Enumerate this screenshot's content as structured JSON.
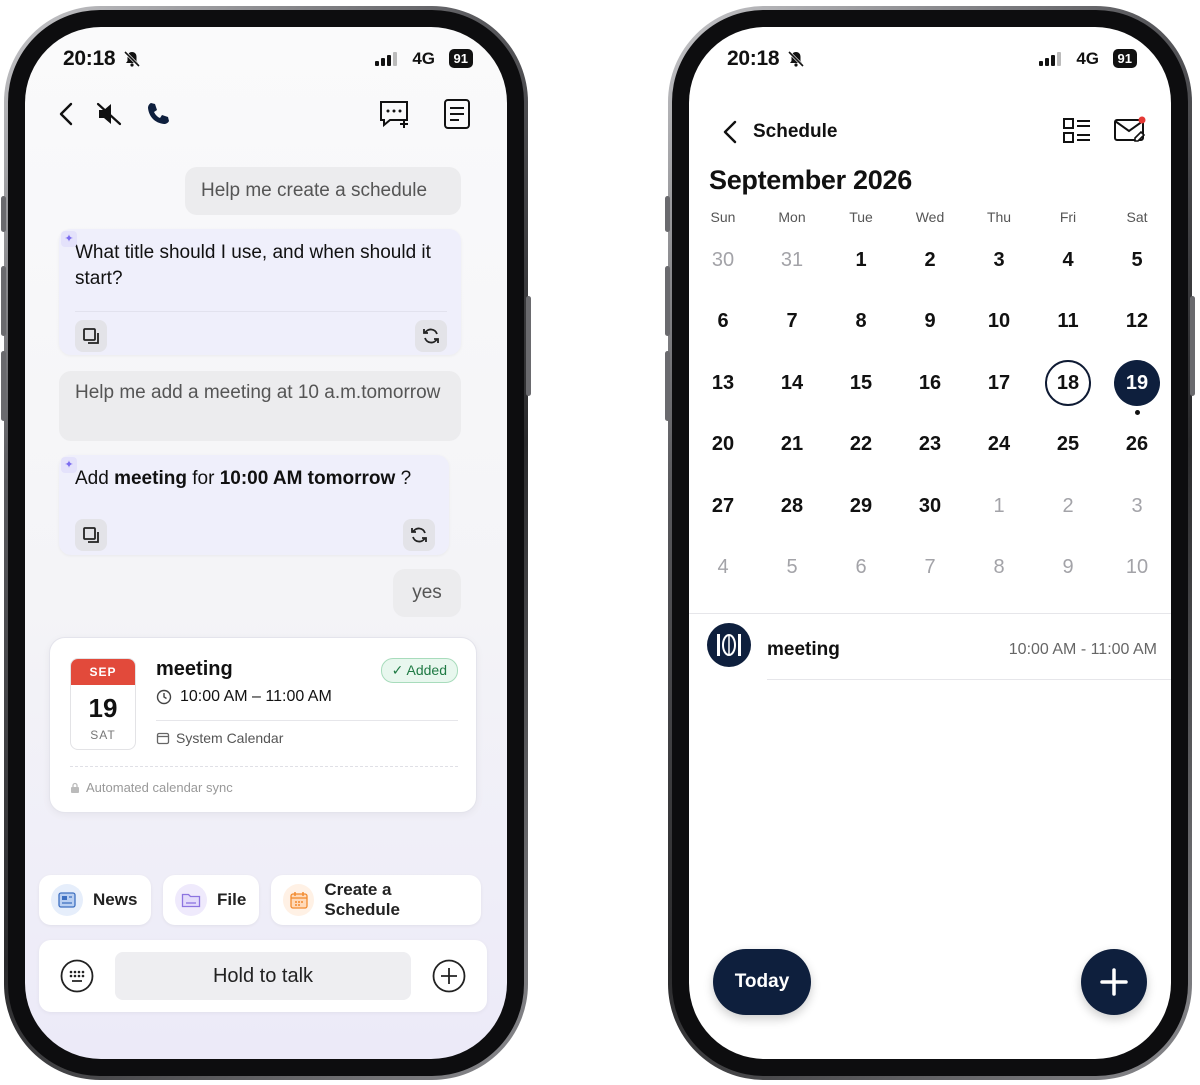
{
  "status": {
    "time": "20:18",
    "network": "4G",
    "battery": "91"
  },
  "chat": {
    "messages": [
      {
        "role": "user",
        "text": "Help me create a schedule"
      },
      {
        "role": "ai",
        "text": "What title should I use, and when should it start?"
      },
      {
        "role": "user",
        "text": "Help me add a meeting at 10 a.m.tomorrow"
      },
      {
        "role": "ai",
        "parts": [
          "Add ",
          "meeting",
          " for ",
          "10:00 AM tomorrow",
          " ?"
        ]
      },
      {
        "role": "user",
        "text": "yes"
      }
    ],
    "event_card": {
      "month": "SEP",
      "day": "19",
      "weekday": "SAT",
      "title": "meeting",
      "time": "10:00 AM – 11:00 AM",
      "status": "✓ Added",
      "calendar": "System Calendar",
      "sync_note": "Automated calendar sync"
    },
    "chips": [
      "News",
      "File",
      "Create a Schedule"
    ],
    "hold_to_talk": "Hold to talk"
  },
  "schedule": {
    "title": "Schedule",
    "month_title": "September 2026",
    "weekdays": [
      "Sun",
      "Mon",
      "Tue",
      "Wed",
      "Thu",
      "Fri",
      "Sat"
    ],
    "weeks": [
      [
        "30",
        "31",
        "1",
        "2",
        "3",
        "4",
        "5"
      ],
      [
        "6",
        "7",
        "8",
        "9",
        "10",
        "11",
        "12"
      ],
      [
        "13",
        "14",
        "15",
        "16",
        "17",
        "18",
        "19"
      ],
      [
        "20",
        "21",
        "22",
        "23",
        "24",
        "25",
        "26"
      ],
      [
        "27",
        "28",
        "29",
        "30",
        "1",
        "2",
        "3"
      ],
      [
        "4",
        "5",
        "6",
        "7",
        "8",
        "9",
        "10"
      ]
    ],
    "today": "18",
    "selected": "19",
    "event": {
      "title": "meeting",
      "time": "10:00 AM - 11:00 AM"
    },
    "today_button": "Today"
  },
  "colors": {
    "navy": "#0e1f3d",
    "added_green": "#1f7a44",
    "date_red": "#e24a3b",
    "ai_bubble": "#efeffb"
  }
}
